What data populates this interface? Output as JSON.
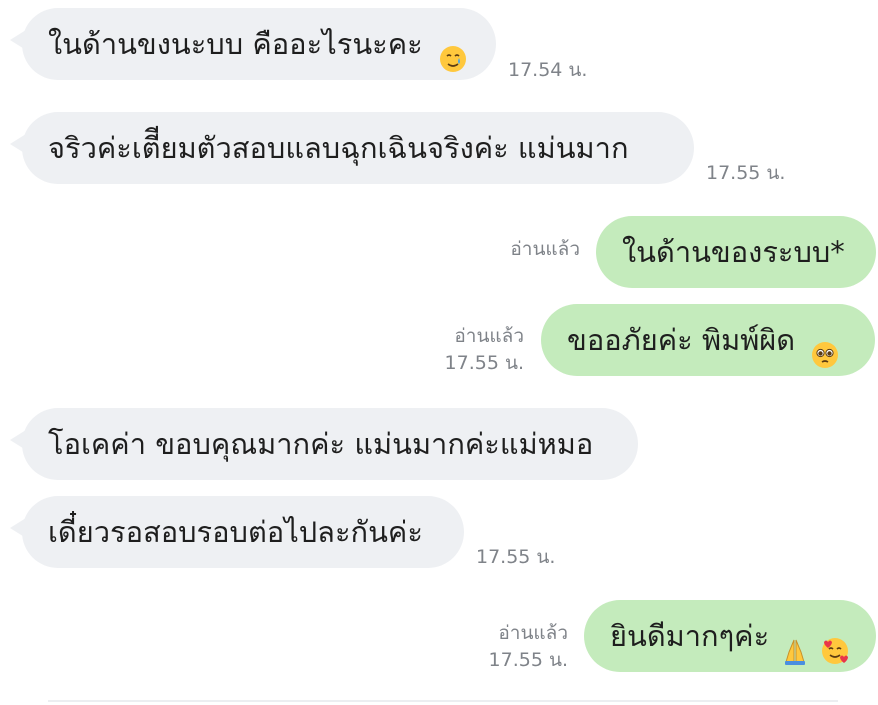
{
  "messages": [
    {
      "direction": "in",
      "text": "ในด้านขงนะบบ คืออะไรนะคะ",
      "emoji": "tear-smile",
      "time": "17.54 น."
    },
    {
      "direction": "in",
      "text": "จริวค่ะเตีียมตัวสอบแลบฉุกเฉินจริงค่ะ แม่นมาก",
      "time": "17.55 น."
    },
    {
      "direction": "out",
      "text": "ในด้านของระบบ*",
      "read": "อ่านแล้ว"
    },
    {
      "direction": "out",
      "text": "ขออภัยค่ะ พิมพ์ผิด",
      "emoji": "pleading-face",
      "read": "อ่านแล้ว",
      "time": "17.55 น."
    },
    {
      "direction": "in",
      "text": "โอเคค่า ขอบคุณมากค่ะ แม่นมากค่ะแม่หมอ"
    },
    {
      "direction": "in",
      "text": "เดี๋ยวรอสอบรอบต่อไปละกันค่ะ",
      "time": "17.55 น."
    },
    {
      "direction": "out",
      "text": "ยินดีมากๆค่ะ",
      "emoji": "folded-hands-and-smiling-hearts",
      "read": "อ่านแล้ว",
      "time": "17.55 น."
    }
  ]
}
